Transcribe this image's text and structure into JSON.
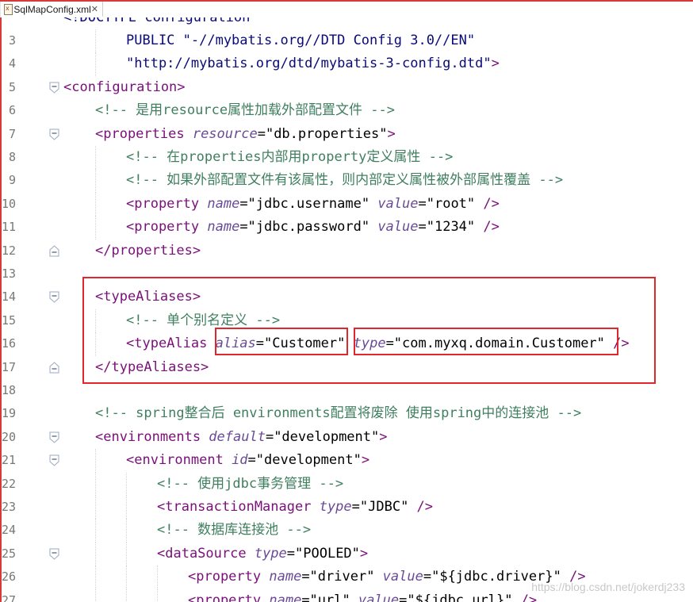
{
  "tab": {
    "title": "SqlMapConfig.xml",
    "close": "✕"
  },
  "watermark": "https://blog.csdn.net/jokerdj233",
  "lines": [
    {
      "n": "3",
      "indent": 2,
      "fold": "",
      "tokens": [
        [
          "doc",
          "PUBLIC \"-//mybatis.org//DTD Config 3.0//EN\""
        ]
      ]
    },
    {
      "n": "4",
      "indent": 2,
      "fold": "",
      "tokens": [
        [
          "doc",
          "\"http://mybatis.org/dtd/mybatis-3-config.dtd\""
        ],
        [
          "tag",
          ">"
        ]
      ]
    },
    {
      "n": "5",
      "indent": 0,
      "fold": "open",
      "tokens": [
        [
          "tag",
          "<configuration>"
        ]
      ]
    },
    {
      "n": "6",
      "indent": 1,
      "fold": "",
      "tokens": [
        [
          "com",
          "<!-- 是用resource属性加载外部配置文件 -->"
        ]
      ]
    },
    {
      "n": "7",
      "indent": 1,
      "fold": "open",
      "tokens": [
        [
          "tag",
          "<properties "
        ],
        [
          "attr",
          "resource"
        ],
        [
          "val",
          "=\"db.properties\""
        ],
        [
          "tag",
          ">"
        ]
      ]
    },
    {
      "n": "8",
      "indent": 2,
      "fold": "",
      "tokens": [
        [
          "com",
          "<!-- 在properties内部用property定义属性 -->"
        ]
      ]
    },
    {
      "n": "9",
      "indent": 2,
      "fold": "",
      "tokens": [
        [
          "com",
          "<!-- 如果外部配置文件有该属性，则内部定义属性被外部属性覆盖 -->"
        ]
      ]
    },
    {
      "n": "10",
      "indent": 2,
      "fold": "",
      "tokens": [
        [
          "tag",
          "<property "
        ],
        [
          "attr",
          "name"
        ],
        [
          "val",
          "=\"jdbc.username\" "
        ],
        [
          "attr",
          "value"
        ],
        [
          "val",
          "=\"root\" "
        ],
        [
          "tag",
          "/>"
        ]
      ]
    },
    {
      "n": "11",
      "indent": 2,
      "fold": "",
      "tokens": [
        [
          "tag",
          "<property "
        ],
        [
          "attr",
          "name"
        ],
        [
          "val",
          "=\"jdbc.password\" "
        ],
        [
          "attr",
          "value"
        ],
        [
          "val",
          "=\"1234\" "
        ],
        [
          "tag",
          "/>"
        ]
      ]
    },
    {
      "n": "12",
      "indent": 1,
      "fold": "close",
      "tokens": [
        [
          "tag",
          "</properties>"
        ]
      ]
    },
    {
      "n": "13",
      "indent": 0,
      "fold": "",
      "tokens": []
    },
    {
      "n": "14",
      "indent": 1,
      "fold": "open",
      "tokens": [
        [
          "tag",
          "<typeAliases>"
        ]
      ]
    },
    {
      "n": "15",
      "indent": 2,
      "fold": "",
      "tokens": [
        [
          "com",
          "<!-- 单个别名定义 -->"
        ]
      ]
    },
    {
      "n": "16",
      "indent": 2,
      "fold": "",
      "tokens": [
        [
          "tag",
          "<typeAlias "
        ],
        [
          "attr",
          "alias"
        ],
        [
          "val",
          "=\"Customer\" "
        ],
        [
          "attr",
          "type"
        ],
        [
          "val",
          "=\"com.myxq.domain.Customer\" "
        ],
        [
          "tag",
          "/>"
        ]
      ]
    },
    {
      "n": "17",
      "indent": 1,
      "fold": "close",
      "tokens": [
        [
          "tag",
          "</typeAliases>"
        ]
      ]
    },
    {
      "n": "18",
      "indent": 0,
      "fold": "",
      "tokens": []
    },
    {
      "n": "19",
      "indent": 1,
      "fold": "",
      "tokens": [
        [
          "com",
          "<!-- spring整合后 environments配置将废除 使用spring中的连接池 -->"
        ]
      ]
    },
    {
      "n": "20",
      "indent": 1,
      "fold": "open",
      "tokens": [
        [
          "tag",
          "<environments "
        ],
        [
          "attr",
          "default"
        ],
        [
          "val",
          "=\"development\""
        ],
        [
          "tag",
          ">"
        ]
      ]
    },
    {
      "n": "21",
      "indent": 2,
      "fold": "open",
      "tokens": [
        [
          "tag",
          "<environment "
        ],
        [
          "attr",
          "id"
        ],
        [
          "val",
          "=\"development\""
        ],
        [
          "tag",
          ">"
        ]
      ]
    },
    {
      "n": "22",
      "indent": 3,
      "fold": "",
      "tokens": [
        [
          "com",
          "<!-- 使用jdbc事务管理 -->"
        ]
      ]
    },
    {
      "n": "23",
      "indent": 3,
      "fold": "",
      "tokens": [
        [
          "tag",
          "<transactionManager "
        ],
        [
          "attr",
          "type"
        ],
        [
          "val",
          "=\"JDBC\" "
        ],
        [
          "tag",
          "/>"
        ]
      ]
    },
    {
      "n": "24",
      "indent": 3,
      "fold": "",
      "tokens": [
        [
          "com",
          "<!-- 数据库连接池 -->"
        ]
      ]
    },
    {
      "n": "25",
      "indent": 3,
      "fold": "open",
      "tokens": [
        [
          "tag",
          "<dataSource "
        ],
        [
          "attr",
          "type"
        ],
        [
          "val",
          "=\"POOLED\""
        ],
        [
          "tag",
          ">"
        ]
      ]
    },
    {
      "n": "26",
      "indent": 4,
      "fold": "",
      "tokens": [
        [
          "tag",
          "<property "
        ],
        [
          "attr",
          "name"
        ],
        [
          "val",
          "=\"driver\" "
        ],
        [
          "attr",
          "value"
        ],
        [
          "val",
          "=\"${jdbc.driver}\" "
        ],
        [
          "tag",
          "/>"
        ]
      ]
    },
    {
      "n": "27",
      "indent": 4,
      "fold": "",
      "tokens": [
        [
          "tag",
          "<property "
        ],
        [
          "attr",
          "name"
        ],
        [
          "val",
          "=\"url\" "
        ],
        [
          "attr",
          "value"
        ],
        [
          "val",
          "=\"${jdbc.url}\" "
        ],
        [
          "tag",
          "/>"
        ]
      ]
    }
  ],
  "highlights": [
    "typeAliases-block",
    "alias-attribute",
    "type-attribute"
  ],
  "colors": {
    "tag": "#7a0f7a",
    "attribute": "#6a4a98",
    "comment": "#3f7f5f",
    "doctype": "#0a0a7a",
    "highlight": "#e0282c"
  }
}
